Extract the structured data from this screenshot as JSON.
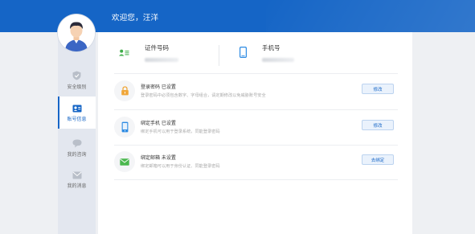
{
  "header": {
    "welcome": "欢迎您，汪洋"
  },
  "sidebar": {
    "items": [
      {
        "label": "安全级别",
        "icon": "shield-icon"
      },
      {
        "label": "账号信息",
        "icon": "id-card-icon",
        "active": true
      },
      {
        "label": "我的咨询",
        "icon": "chat-bubble-icon"
      },
      {
        "label": "我的消息",
        "icon": "envelope-icon"
      }
    ]
  },
  "account": {
    "id_label": "证件号码",
    "phone_label": "手机号"
  },
  "security": {
    "items": [
      {
        "title": "登录密码 已设置",
        "desc": "登录密码中必须包含数字、字母组合，请定期修改以免威胁账号安全",
        "button": "修改",
        "icon": "lock-icon",
        "accent": "#f0a73a"
      },
      {
        "title": "绑定手机 已设置",
        "desc": "绑定手机可以用于登录系统，同能登录密码",
        "button": "修改",
        "icon": "phone-icon",
        "accent": "#2d8be3"
      },
      {
        "title": "绑定邮箱 未设置",
        "desc": "绑定邮箱可以用于身份认证、同能登录密码",
        "button": "去绑定",
        "icon": "mail-icon",
        "accent": "#4bb84f"
      }
    ]
  },
  "colors": {
    "brand": "#1565c6",
    "sidebar": "#e3e7ef",
    "background": "#eef0f3"
  }
}
